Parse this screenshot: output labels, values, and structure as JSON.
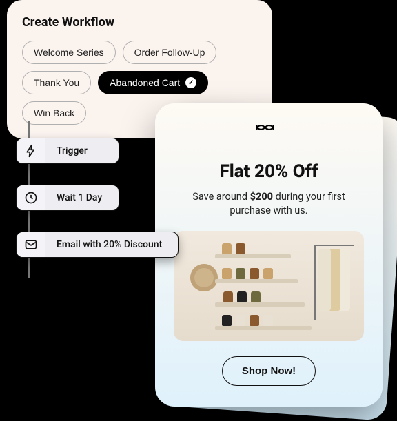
{
  "workflow": {
    "title": "Create Workflow",
    "templates": [
      {
        "label": "Welcome Series",
        "active": false
      },
      {
        "label": "Order Follow-Up",
        "active": false
      },
      {
        "label": "Thank You",
        "active": false
      },
      {
        "label": "Abandoned Cart",
        "active": true
      },
      {
        "label": "Win Back",
        "active": false
      }
    ],
    "steps": [
      {
        "icon": "bolt",
        "label": "Trigger"
      },
      {
        "icon": "clock",
        "label": "Wait 1 Day"
      },
      {
        "icon": "mail",
        "label": "Email with 20% Discount"
      }
    ]
  },
  "email_preview": {
    "logo": "infinity",
    "headline": "Flat 20% Off",
    "sub_prefix": "Save around ",
    "sub_amount": "$200",
    "sub_suffix": " during your first purchase with us.",
    "image_alt": "Retail boutique shelves with boots and a clothing rack",
    "cta": "Shop Now!"
  }
}
